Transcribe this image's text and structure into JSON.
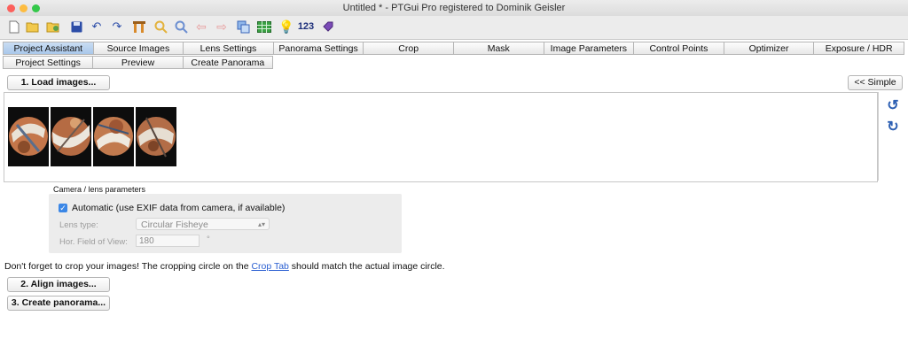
{
  "window": {
    "title": "Untitled * - PTGui Pro registered to Dominik Geisler"
  },
  "toolbar": {
    "icons": [
      "new-file-icon",
      "open-folder-icon",
      "open-recent-icon",
      "save-icon",
      "undo-icon",
      "redo-icon",
      "tools-icon",
      "zoom-in-icon",
      "zoom-out-icon",
      "arrow-left-icon",
      "arrow-right-icon",
      "copy-icon",
      "table-icon",
      "lightbulb-icon",
      "numbering-icon",
      "tag-icon"
    ],
    "numbering_label": "123"
  },
  "tabs_row1": [
    "Project Assistant",
    "Source Images",
    "Lens Settings",
    "Panorama Settings",
    "Crop",
    "Mask",
    "Image Parameters",
    "Control Points",
    "Optimizer",
    "Exposure / HDR"
  ],
  "tabs_row2": [
    "Project Settings",
    "Preview",
    "Create Panorama"
  ],
  "buttons": {
    "load": "1. Load images...",
    "simple": "<< Simple",
    "align": "2. Align images...",
    "create": "3. Create panorama..."
  },
  "images": {
    "count": 4
  },
  "camera": {
    "group_label": "Camera / lens parameters",
    "automatic_label": "Automatic (use EXIF data from camera, if available)",
    "automatic_checked": true,
    "lens_type_label": "Lens type:",
    "lens_type_value": "Circular Fisheye",
    "hfov_label": "Hor. Field of View:",
    "hfov_value": "180",
    "hfov_unit": "°"
  },
  "note": {
    "before": "Don't forget to crop your images! The cropping circle on the ",
    "link": "Crop Tab",
    "after": " should match the actual image circle."
  },
  "colors": {
    "accent": "#3b87e6",
    "link": "#2a5fd1",
    "active_tab": "#b9d3f0"
  }
}
